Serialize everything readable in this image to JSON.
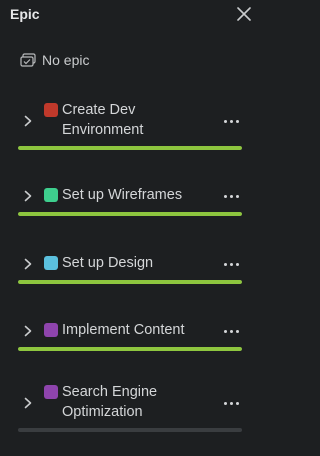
{
  "panel": {
    "title": "Epic",
    "no_epic_label": "No epic"
  },
  "epics": [
    {
      "name": "Create Dev Environment",
      "color": "#c0392b",
      "progress": 1.0
    },
    {
      "name": "Set up Wireframes",
      "color": "#3ecf8e",
      "progress": 1.0
    },
    {
      "name": "Set up Design",
      "color": "#5bc0de",
      "progress": 1.0
    },
    {
      "name": "Implement Content",
      "color": "#8e44ad",
      "progress": 1.0
    },
    {
      "name": "Search Engine Optimization",
      "color": "#8e44ad",
      "progress": 0.0
    }
  ],
  "colors": {
    "background": "#1d1f21",
    "progress_fill": "#8ec63f",
    "progress_track": "#3a3d40"
  },
  "icons": {
    "close": "close-icon",
    "no_epic": "no-epic-icon",
    "expand": "chevron-right-icon",
    "more": "more-horizontal-icon"
  }
}
